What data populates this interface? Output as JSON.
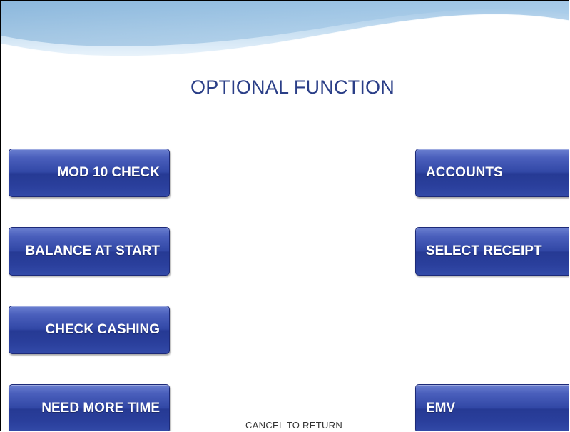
{
  "screen": {
    "title": "OPTIONAL FUNCTION",
    "footer_hint": "CANCEL TO RETURN"
  },
  "left_keys": [
    {
      "label": "MOD 10 CHECK"
    },
    {
      "label": "BALANCE AT START"
    },
    {
      "label": "CHECK CASHING"
    },
    {
      "label": "NEED MORE TIME"
    }
  ],
  "right_keys": [
    {
      "label": "ACCOUNTS"
    },
    {
      "label": "SELECT RECEIPT"
    },
    {
      "label": "EMV"
    }
  ],
  "colors": {
    "title": "#2a3e87",
    "button": "#3248a6",
    "button_text": "#ffffff",
    "header_wave": "#8fb8dc"
  }
}
